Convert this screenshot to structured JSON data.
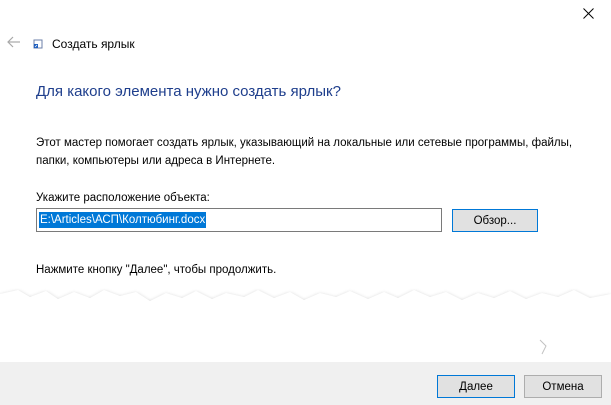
{
  "window": {
    "title": "Создать ярлык",
    "close_glyph": "✕",
    "back_glyph": "←"
  },
  "main": {
    "heading": "Для какого элемента нужно создать ярлык?",
    "description": "Этот мастер помогает создать ярлык, указывающий на локальные или сетевые программы, файлы, папки, компьютеры или адреса в Интернете.",
    "location_label": "Укажите расположение объекта:",
    "location_value": "E:\\Articles\\АСП\\Колтюбинг.docx",
    "browse_label": "Обзор...",
    "continue_hint": "Нажмите кнопку \"Далее\", чтобы продолжить."
  },
  "footer": {
    "next_label": "Далее",
    "cancel_label": "Отмена"
  },
  "colors": {
    "heading": "#1e3e8c",
    "selection": "#0078d7",
    "footer_bg": "#f0f0f0"
  },
  "icons": {
    "close": "close-icon",
    "back": "back-arrow-icon",
    "app": "shortcut-app-icon"
  }
}
